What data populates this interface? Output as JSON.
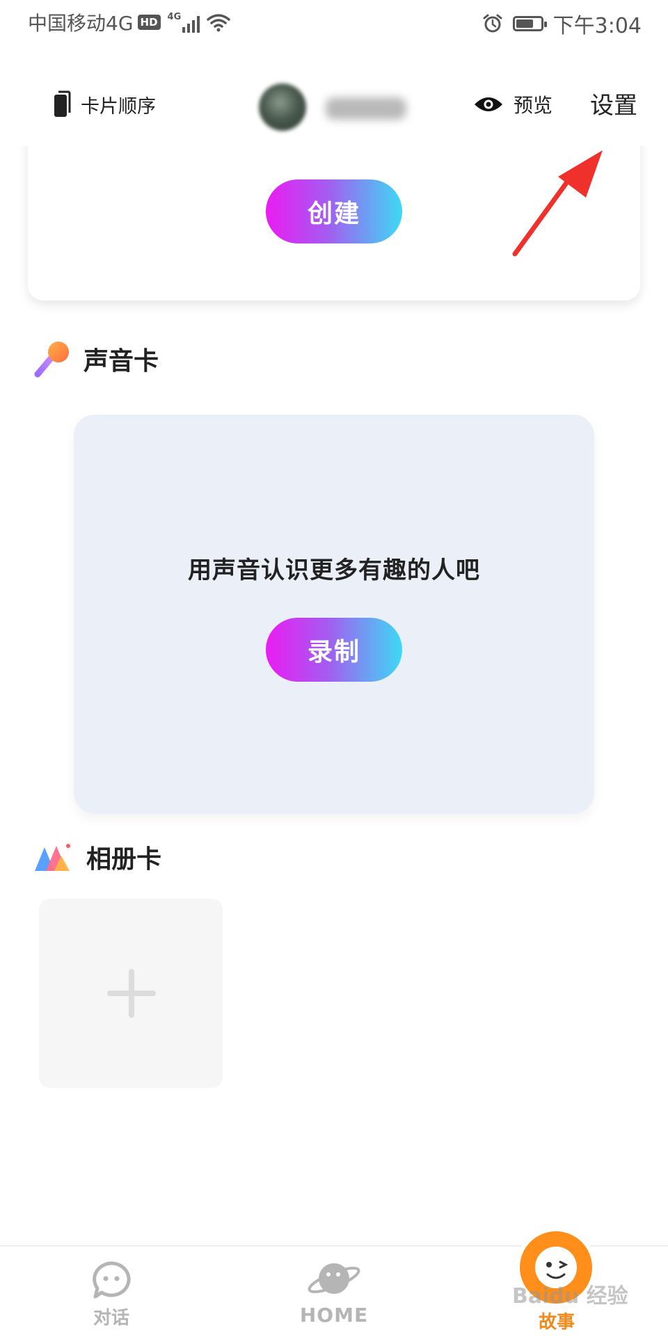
{
  "status_bar": {
    "carrier": "中国移动4G",
    "hd_badge": "HD",
    "network": "4G",
    "time": "下午3:04",
    "battery_level": 0.7
  },
  "header": {
    "card_order_label": "卡片顺序",
    "preview_label": "预览",
    "settings_label": "设置"
  },
  "top_card": {
    "create_button_label": "创建"
  },
  "voice_section": {
    "title": "声音卡",
    "prompt": "用声音认识更多有趣的人吧",
    "record_button_label": "录制"
  },
  "album_section": {
    "title": "相册卡"
  },
  "bottom_nav": {
    "items": [
      {
        "label": "对话",
        "icon": "chat-bubble-icon"
      },
      {
        "label": "HOME",
        "icon": "planet-icon"
      },
      {
        "label": "故事",
        "icon": "story-face-icon"
      }
    ],
    "active_index": 2,
    "active_color": "#f08a1c"
  },
  "watermark": "Baidu 经验",
  "colors": {
    "button_gradient": [
      "#ea1cf3",
      "#a45cf0",
      "#3dd9f5"
    ],
    "annotation_arrow": "#f0302a",
    "voice_card_bg": "#ebf0f8"
  }
}
